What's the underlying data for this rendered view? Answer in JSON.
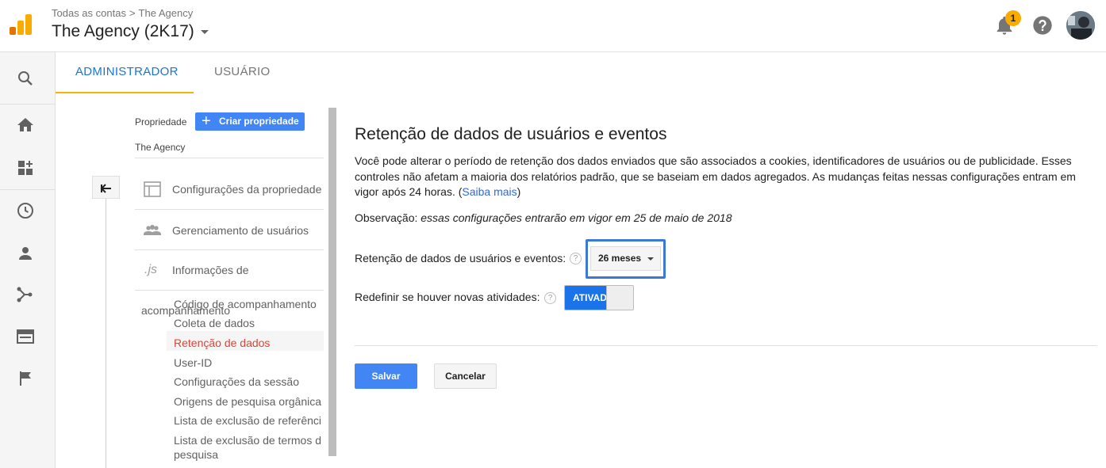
{
  "header": {
    "breadcrumb_root": "Todas as contas",
    "breadcrumb_sep": ">",
    "breadcrumb_current": "The Agency",
    "account_title": "The Agency (2K17)",
    "notification_count": "1"
  },
  "rail": {
    "icons": [
      "search-icon",
      "home-icon",
      "customization-icon",
      "realtime-clock-icon",
      "audience-person-icon",
      "acquisition-icon",
      "behavior-icon",
      "conversions-flag-icon"
    ]
  },
  "tabs": {
    "admin": "ADMINISTRADOR",
    "user": "USUÁRIO"
  },
  "navigator": {
    "property_label": "Propriedade",
    "create_property": "Criar propriedade",
    "property_name": "The Agency",
    "rows": {
      "settings": "Configurações da propriedade",
      "users": "Gerenciamento de usuários",
      "tracking_info": "Informações de",
      "tracking_info_wrap": "acompanhamento"
    },
    "subitems": {
      "tracking_code": "Código de acompanhamento",
      "data_collection": "Coleta de dados",
      "data_retention": "Retenção de dados",
      "user_id": "User-ID",
      "session_settings": "Configurações da sessão",
      "organic_sources": "Origens de pesquisa orgânica",
      "referral_exclusion": "Lista de exclusão de referênci",
      "search_term_exclusion_1": "Lista de exclusão de termos d",
      "search_term_exclusion_2": "pesquisa"
    }
  },
  "main": {
    "title": "Retenção de dados de usuários e eventos",
    "description": "Você pode alterar o período de retenção dos dados enviados que são associados a cookies, identificadores de usuários ou de publicidade. Esses controles não afetam a maioria dos relatórios padrão, que se baseiam em dados agregados. As mudanças feitas nessas configurações entram em vigor após 24 horas. (",
    "learn_more": "Saiba mais",
    "description_end": ")",
    "observation_label": "Observação:",
    "observation_text": "essas configurações entrarão em vigor em 25 de maio de 2018",
    "retention_label": "Retenção de dados de usuários e eventos:",
    "retention_value": "26 meses",
    "reset_label": "Redefinir se houver novas atividades:",
    "toggle_state": "ATIVADO",
    "help_glyph": "?",
    "save": "Salvar",
    "cancel": "Cancelar"
  },
  "colors": {
    "accent_blue": "#4285f4",
    "tab_active": "#1976d2",
    "tab_underline": "#f4b400",
    "active_nav": "#db4437",
    "highlight_box": "#3c78d8"
  }
}
